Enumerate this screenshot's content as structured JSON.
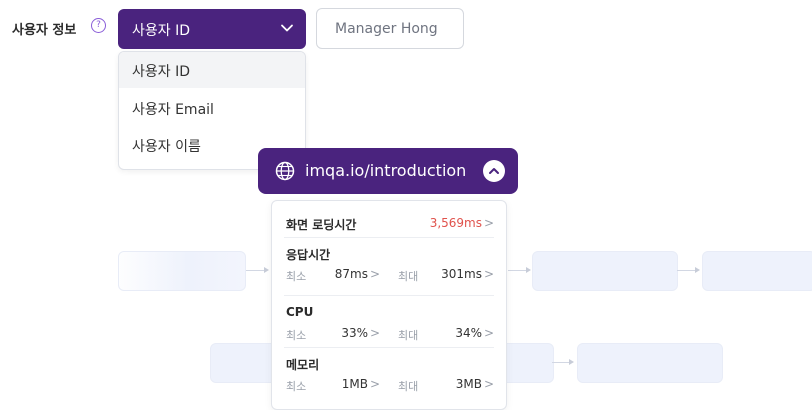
{
  "user_info": {
    "label": "사용자 정보",
    "help_icon": "?",
    "select_value": "사용자 ID",
    "options": [
      "사용자 ID",
      "사용자 Email",
      "사용자 이름"
    ],
    "input_value": "Manager Hong"
  },
  "url_pill": {
    "url": "imqa.io/introduction",
    "icon": "globe-icon"
  },
  "metrics": {
    "screen_loading": {
      "label": "화면 로딩시간",
      "value": "3,569ms",
      "value_color": "#e0524c"
    },
    "response_time": {
      "label": "응답시간",
      "min_label": "최소",
      "min_value": "87ms",
      "max_label": "최대",
      "max_value": "301ms"
    },
    "cpu": {
      "label": "CPU",
      "min_label": "최소",
      "min_value": "33%",
      "max_label": "최대",
      "max_value": "34%"
    },
    "memory": {
      "label": "메모리",
      "min_label": "최소",
      "min_value": "1MB",
      "max_label": "최대",
      "max_value": "3MB"
    },
    "chevron": ">"
  },
  "colors": {
    "primary": "#4a237e",
    "accent_red": "#e0524c"
  }
}
